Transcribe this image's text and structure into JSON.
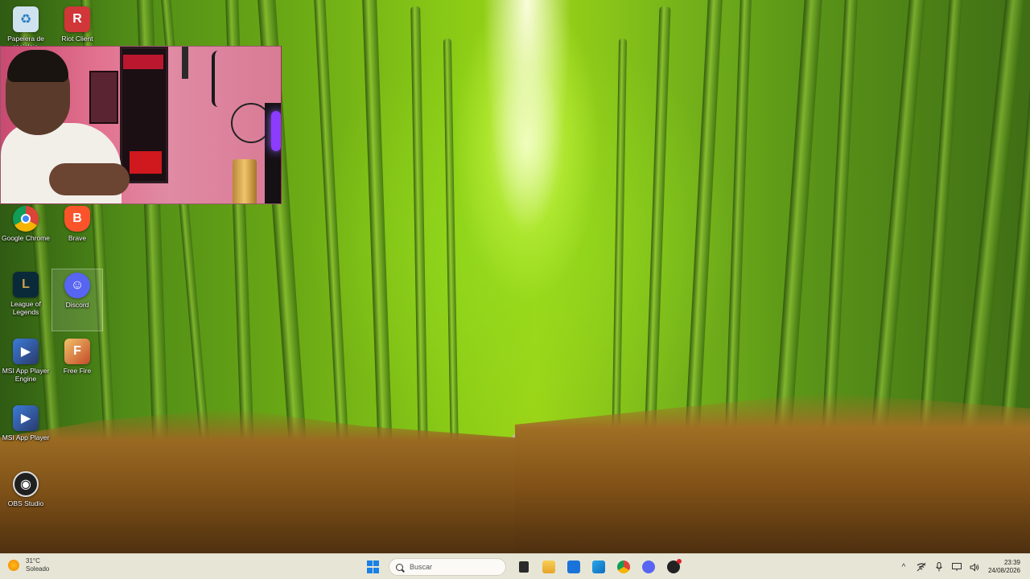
{
  "desktop": {
    "icons": [
      {
        "label": "Papelera de reciclaje",
        "icon": "recycle-bin-icon",
        "color": "#cfe2ef",
        "glyph": "♻"
      },
      {
        "label": "Riot Client",
        "icon": "riot-client-icon",
        "color": "#d13639",
        "glyph": "R"
      },
      {
        "label": "Google Chrome",
        "icon": "chrome-icon",
        "color": "#db4437",
        "glyph": ""
      },
      {
        "label": "Brave",
        "icon": "brave-icon",
        "color": "#fb542b",
        "glyph": "B"
      },
      {
        "label": "League of Legends",
        "icon": "league-of-legends-icon",
        "color": "#0a2a3a",
        "glyph": "L"
      },
      {
        "label": "Discord",
        "icon": "discord-icon",
        "color": "#5865f2",
        "glyph": "☺"
      },
      {
        "label": "MSI App Player Engine",
        "icon": "msi-app-player-engine-icon",
        "color": "#2b3a6b",
        "glyph": "▶"
      },
      {
        "label": "Free Fire",
        "icon": "free-fire-icon",
        "color": "#c44a2a",
        "glyph": "F"
      },
      {
        "label": "MSI App Player",
        "icon": "msi-app-player-icon",
        "color": "#2b3a6b",
        "glyph": "▶"
      },
      {
        "label": "OBS Studio",
        "icon": "obs-studio-icon",
        "color": "#1f1f1f",
        "glyph": "◉"
      }
    ]
  },
  "taskbar": {
    "weather_temp": "31°C",
    "weather_desc": "Soleado",
    "search_placeholder": "Buscar",
    "pinned": [
      {
        "icon": "task-view-icon",
        "color": "#2a2a2a"
      },
      {
        "icon": "file-explorer-icon",
        "color": "#f5b82e"
      },
      {
        "icon": "microsoft-store-icon",
        "color": "#1a73d8"
      },
      {
        "icon": "outlook-icon",
        "color": "#0f6cbd"
      },
      {
        "icon": "chrome-icon",
        "color": "#db4437"
      },
      {
        "icon": "discord-icon",
        "color": "#5865f2"
      },
      {
        "icon": "riot-app-icon",
        "color": "#222222"
      }
    ],
    "tray": {
      "chevron": "^",
      "time": "23:39",
      "date": "24/08/2026"
    }
  },
  "webcam": {
    "label": "webcam overlay"
  }
}
